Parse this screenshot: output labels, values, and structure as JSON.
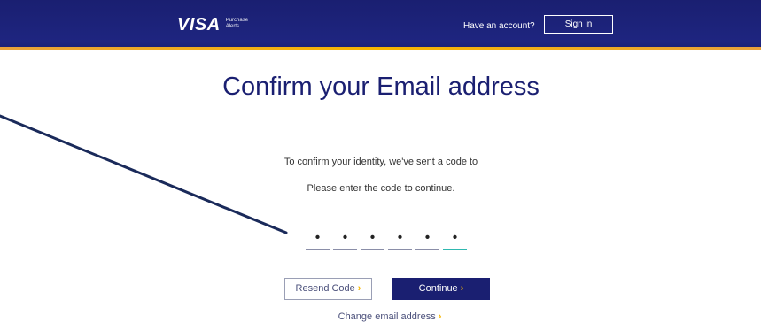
{
  "header": {
    "logo": "VISA",
    "logo_sub_1": "Purchase",
    "logo_sub_2": "Alerts",
    "account_prompt": "Have an account?",
    "signin_label": "Sign in"
  },
  "main": {
    "title": "Confirm your Email address",
    "description": "To confirm your identity, we've sent a code to",
    "email": "",
    "instruction": "Please enter the code to continue.",
    "code_digits": [
      "•",
      "•",
      "•",
      "•",
      "•",
      "•"
    ],
    "resend_label": "Resend Code",
    "continue_label": "Continue",
    "change_email_label": "Change email address",
    "chevron": "›"
  },
  "colors": {
    "brand_navy": "#1a1f71",
    "accent_gold": "#f7b600",
    "active_field": "#2fb8b0"
  },
  "icons": [
    "chevron-right-icon"
  ]
}
